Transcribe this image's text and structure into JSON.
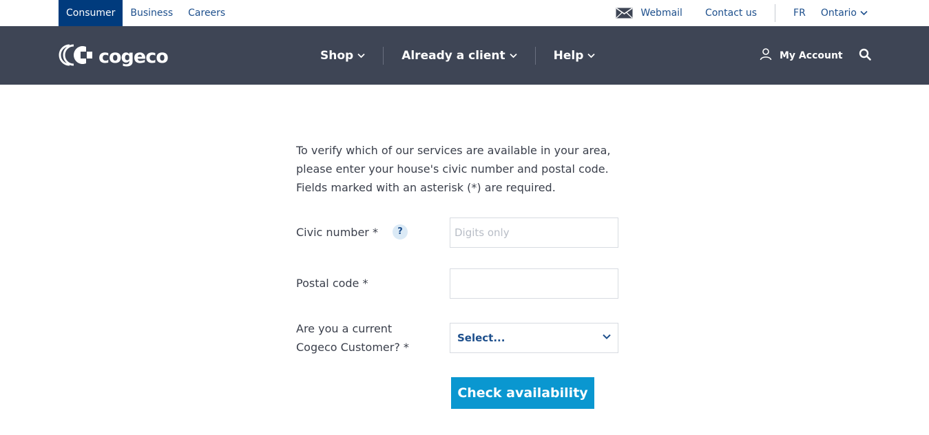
{
  "topbar": {
    "segments": [
      {
        "label": "Consumer"
      },
      {
        "label": "Business"
      },
      {
        "label": "Careers"
      }
    ],
    "webmail": "Webmail",
    "contact": "Contact us",
    "language": "FR",
    "region": "Ontario"
  },
  "header": {
    "logo_text": "cogeco",
    "menu": [
      {
        "label": "Shop"
      },
      {
        "label": "Already a client"
      },
      {
        "label": "Help"
      }
    ],
    "account": "My Account"
  },
  "form": {
    "intro_lines": [
      "To verify which of our services are available in your area,",
      "please enter your house's civic number and postal code.",
      "Fields marked with an asterisk (*) are required."
    ],
    "civic_label": "Civic number *",
    "help_glyph": "?",
    "civic_placeholder": "Digits only",
    "civic_value": "",
    "postal_label": "Postal code *",
    "postal_value": "",
    "customer_label_lines": [
      "Are you a current",
      "Cogeco Customer? *"
    ],
    "customer_select_value": "Select...",
    "submit_label": "Check availability"
  },
  "icons": {
    "mail": "envelope-icon",
    "chevron": "chevron-down-icon",
    "user": "user-icon",
    "search": "search-icon",
    "help": "help-icon"
  },
  "colors": {
    "nav_bg": "#3e4555",
    "active_segment": "#003b7d",
    "link": "#1d4f8c",
    "button": "#0a97d0"
  }
}
